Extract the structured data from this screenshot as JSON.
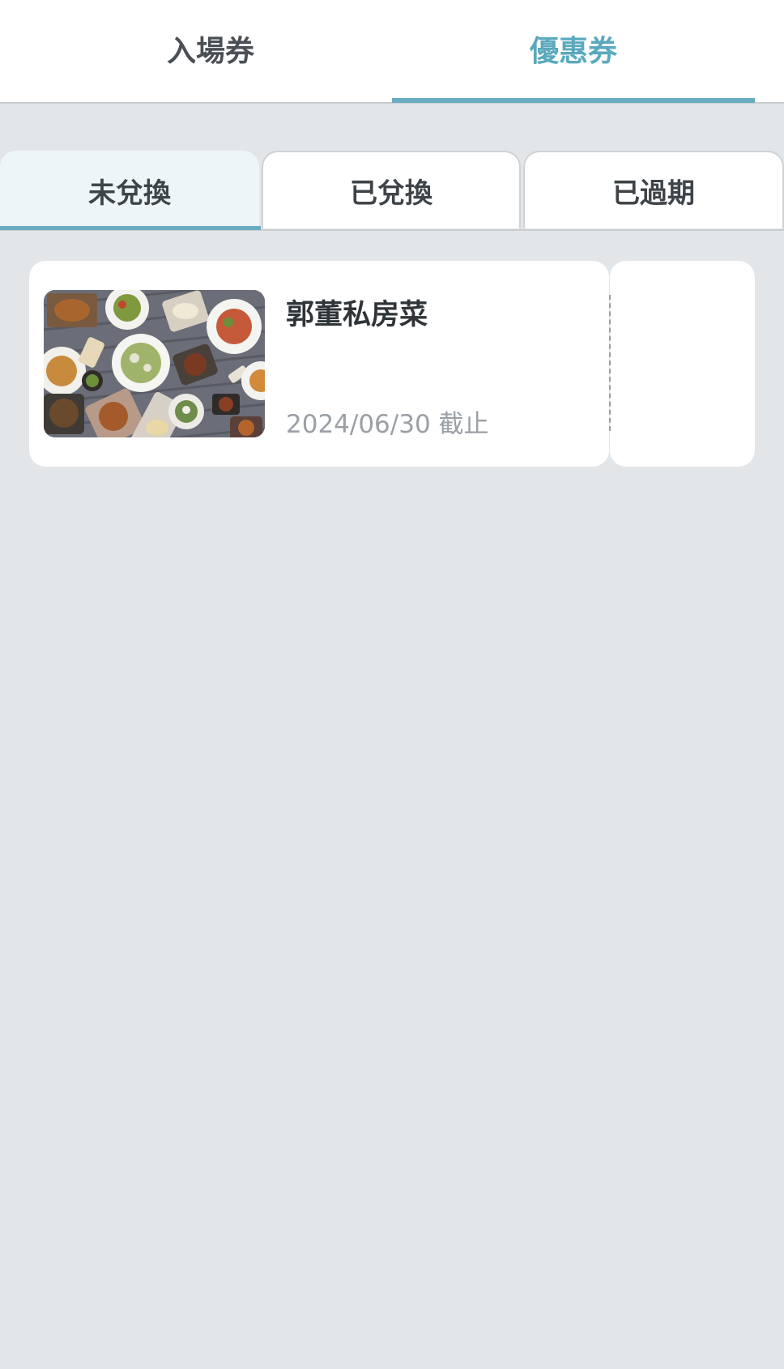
{
  "top_tabs": [
    {
      "label": "入場券",
      "active": false
    },
    {
      "label": "優惠券",
      "active": true
    }
  ],
  "sub_tabs": [
    {
      "label": "未兌換",
      "active": true
    },
    {
      "label": "已兌換",
      "active": false
    },
    {
      "label": "已過期",
      "active": false
    }
  ],
  "coupons": [
    {
      "title": "郭董私房菜",
      "expiry": "2024/06/30 截止",
      "image": "food-spread-photo"
    }
  ],
  "colors": {
    "accent": "#5aa9bd",
    "background": "#e3e6e8",
    "card": "#ffffff",
    "active_subtab_bg": "#eef5f8"
  }
}
